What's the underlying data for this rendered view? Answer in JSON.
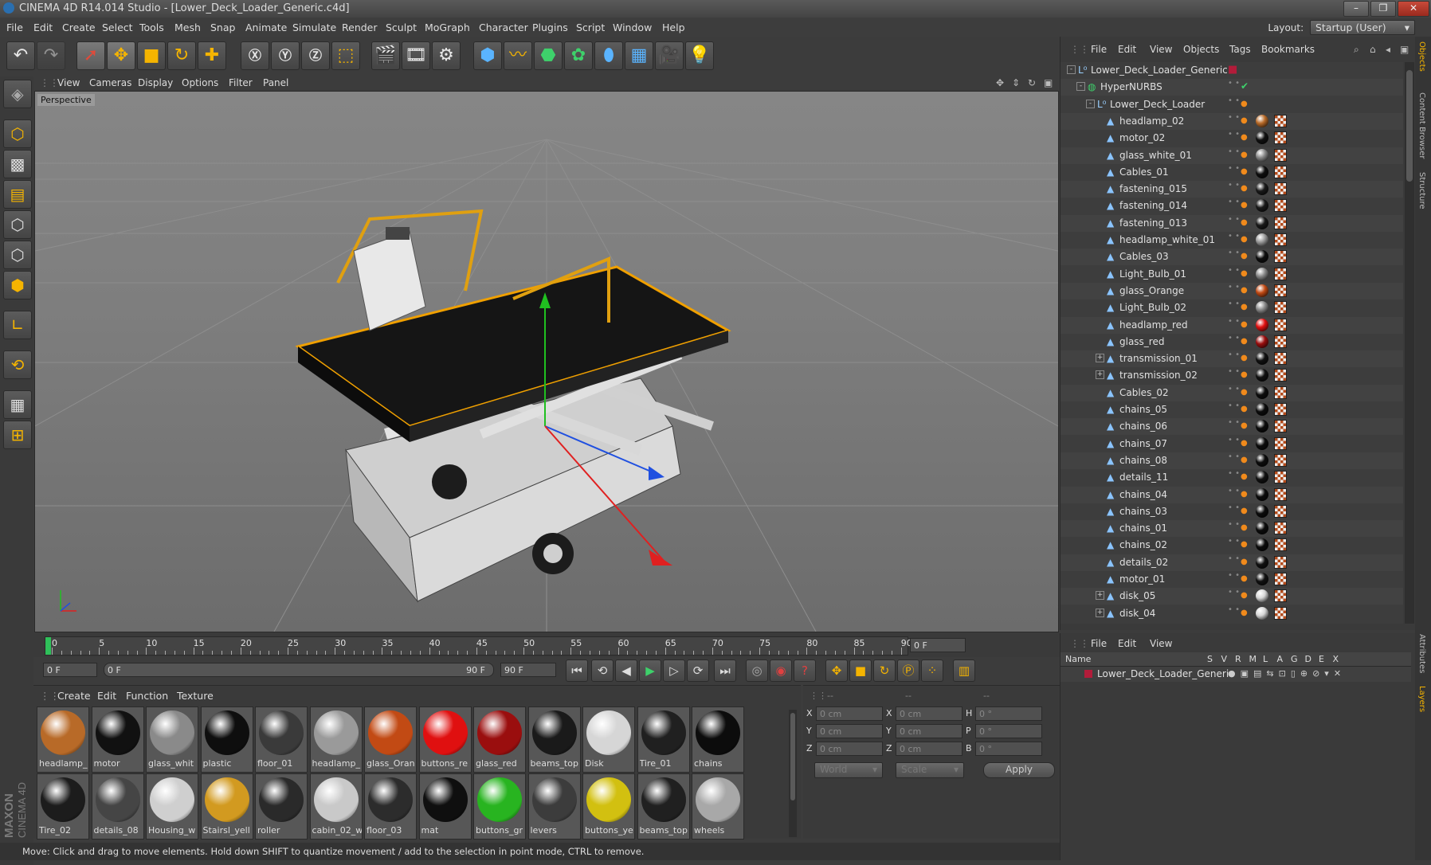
{
  "window": {
    "title": "CINEMA 4D R14.014 Studio - [Lower_Deck_Loader_Generic.c4d]"
  },
  "menu": [
    "File",
    "Edit",
    "Create",
    "Select",
    "Tools",
    "Mesh",
    "Snap",
    "Animate",
    "Simulate",
    "Render",
    "Sculpt",
    "MoGraph",
    "Character",
    "Plugins",
    "Script",
    "Window",
    "Help"
  ],
  "layout": {
    "label": "Layout:",
    "value": "Startup (User)"
  },
  "viewport": {
    "menu": [
      "View",
      "Cameras",
      "Display",
      "Options",
      "Filter",
      "Panel"
    ],
    "camera_label": "Perspective"
  },
  "timeline": {
    "ticks": [
      "0",
      "5",
      "10",
      "15",
      "20",
      "25",
      "30",
      "35",
      "40",
      "45",
      "50",
      "55",
      "60",
      "65",
      "70",
      "75",
      "80",
      "85",
      "90"
    ],
    "current_frame": "0 F",
    "start_field": "0 F",
    "range_start": "0 F",
    "range_end": "90 F",
    "end_field": "90 F"
  },
  "materials": {
    "menu": [
      "Create",
      "Edit",
      "Function",
      "Texture"
    ],
    "row1": [
      {
        "name": "headlamp_",
        "color": "#b86a28"
      },
      {
        "name": "motor",
        "color": "#111111"
      },
      {
        "name": "glass_whit",
        "color": "#8a8a8a"
      },
      {
        "name": "plastic",
        "color": "#0e0e0e"
      },
      {
        "name": "floor_01",
        "color": "#3a3a3a"
      },
      {
        "name": "headlamp_",
        "color": "#9a9a9a"
      },
      {
        "name": "glass_Oran",
        "color": "#c24a14"
      },
      {
        "name": "buttons_re",
        "color": "#e01010"
      },
      {
        "name": "glass_red",
        "color": "#9a0e0e"
      },
      {
        "name": "beams_top",
        "color": "#1a1a1a"
      },
      {
        "name": "Disk",
        "color": "#d6d6d6"
      },
      {
        "name": "Tire_01",
        "color": "#202020"
      },
      {
        "name": "chains",
        "color": "#0c0c0c"
      }
    ],
    "row2": [
      {
        "name": "Tire_02",
        "color": "#1c1c1c"
      },
      {
        "name": "details_08",
        "color": "#454545"
      },
      {
        "name": "Housing_w",
        "color": "#cfcfcf"
      },
      {
        "name": "Stairsl_yell",
        "color": "#d29a20"
      },
      {
        "name": "roller",
        "color": "#2a2a2a"
      },
      {
        "name": "cabin_02_w",
        "color": "#c9c9c9"
      },
      {
        "name": "floor_03",
        "color": "#2c2c2c"
      },
      {
        "name": "mat",
        "color": "#0f0f0f"
      },
      {
        "name": "buttons_gr",
        "color": "#28b420"
      },
      {
        "name": "levers",
        "color": "#3c3c3c"
      },
      {
        "name": "buttons_ye",
        "color": "#d2c010"
      },
      {
        "name": "beams_top",
        "color": "#202020"
      },
      {
        "name": "wheels",
        "color": "#a8a8a8"
      }
    ]
  },
  "coords": {
    "header": [
      "--",
      "--",
      "--"
    ],
    "rows": [
      {
        "a": "X",
        "av": "0 cm",
        "b": "X",
        "bv": "0 cm",
        "c": "H",
        "cv": "0 °"
      },
      {
        "a": "Y",
        "av": "0 cm",
        "b": "Y",
        "bv": "0 cm",
        "c": "P",
        "cv": "0 °"
      },
      {
        "a": "Z",
        "av": "0 cm",
        "b": "Z",
        "bv": "0 cm",
        "c": "B",
        "cv": "0 °"
      }
    ],
    "mode": "World",
    "scale": "Scale",
    "apply": "Apply"
  },
  "status": "Move: Click and drag to move elements. Hold down SHIFT to quantize movement / add to the selection in point mode, CTRL to remove.",
  "objects": {
    "menu": [
      "File",
      "Edit",
      "View",
      "Objects",
      "Tags",
      "Bookmarks"
    ],
    "items": [
      {
        "name": "Lower_Deck_Loader_Generic",
        "indent": 0,
        "type": "null",
        "mat": "",
        "expand": "-"
      },
      {
        "name": "HyperNURBS",
        "indent": 1,
        "type": "nurbs",
        "mat": "",
        "expand": "-"
      },
      {
        "name": "Lower_Deck_Loader",
        "indent": 2,
        "type": "null",
        "mat": "",
        "expand": "-"
      },
      {
        "name": "headlamp_02",
        "indent": 3,
        "type": "poly",
        "mat": "#b86a28",
        "expand": ""
      },
      {
        "name": "motor_02",
        "indent": 3,
        "type": "poly",
        "mat": "#111111",
        "expand": ""
      },
      {
        "name": "glass_white_01",
        "indent": 3,
        "type": "poly",
        "mat": "#8a8a8a",
        "expand": ""
      },
      {
        "name": "Cables_01",
        "indent": 3,
        "type": "poly",
        "mat": "#0e0e0e",
        "expand": ""
      },
      {
        "name": "fastening_015",
        "indent": 3,
        "type": "poly",
        "mat": "#1a1a1a",
        "expand": ""
      },
      {
        "name": "fastening_014",
        "indent": 3,
        "type": "poly",
        "mat": "#1a1a1a",
        "expand": ""
      },
      {
        "name": "fastening_013",
        "indent": 3,
        "type": "poly",
        "mat": "#1a1a1a",
        "expand": ""
      },
      {
        "name": "headlamp_white_01",
        "indent": 3,
        "type": "poly",
        "mat": "#9a9a9a",
        "expand": ""
      },
      {
        "name": "Cables_03",
        "indent": 3,
        "type": "poly",
        "mat": "#0e0e0e",
        "expand": ""
      },
      {
        "name": "Light_Bulb_01",
        "indent": 3,
        "type": "poly",
        "mat": "#8a8a8a",
        "expand": ""
      },
      {
        "name": "glass_Orange",
        "indent": 3,
        "type": "poly",
        "mat": "#c24a14",
        "expand": ""
      },
      {
        "name": "Light_Bulb_02",
        "indent": 3,
        "type": "poly",
        "mat": "#8a8a8a",
        "expand": ""
      },
      {
        "name": "headlamp_red",
        "indent": 3,
        "type": "poly",
        "mat": "#e01010",
        "expand": ""
      },
      {
        "name": "glass_red",
        "indent": 3,
        "type": "poly",
        "mat": "#9a0e0e",
        "expand": ""
      },
      {
        "name": "transmission_01",
        "indent": 3,
        "type": "poly",
        "mat": "#111111",
        "expand": "+"
      },
      {
        "name": "transmission_02",
        "indent": 3,
        "type": "poly",
        "mat": "#111111",
        "expand": "+"
      },
      {
        "name": "Cables_02",
        "indent": 3,
        "type": "poly",
        "mat": "#0e0e0e",
        "expand": ""
      },
      {
        "name": "chains_05",
        "indent": 3,
        "type": "poly",
        "mat": "#0c0c0c",
        "expand": ""
      },
      {
        "name": "chains_06",
        "indent": 3,
        "type": "poly",
        "mat": "#0c0c0c",
        "expand": ""
      },
      {
        "name": "chains_07",
        "indent": 3,
        "type": "poly",
        "mat": "#0c0c0c",
        "expand": ""
      },
      {
        "name": "chains_08",
        "indent": 3,
        "type": "poly",
        "mat": "#0c0c0c",
        "expand": ""
      },
      {
        "name": "details_11",
        "indent": 3,
        "type": "poly",
        "mat": "#111111",
        "expand": ""
      },
      {
        "name": "chains_04",
        "indent": 3,
        "type": "poly",
        "mat": "#0c0c0c",
        "expand": ""
      },
      {
        "name": "chains_03",
        "indent": 3,
        "type": "poly",
        "mat": "#0c0c0c",
        "expand": ""
      },
      {
        "name": "chains_01",
        "indent": 3,
        "type": "poly",
        "mat": "#0c0c0c",
        "expand": ""
      },
      {
        "name": "chains_02",
        "indent": 3,
        "type": "poly",
        "mat": "#0c0c0c",
        "expand": ""
      },
      {
        "name": "details_02",
        "indent": 3,
        "type": "poly",
        "mat": "#111111",
        "expand": ""
      },
      {
        "name": "motor_01",
        "indent": 3,
        "type": "poly",
        "mat": "#111111",
        "expand": ""
      },
      {
        "name": "disk_05",
        "indent": 3,
        "type": "poly",
        "mat": "#d6d6d6",
        "expand": "+"
      },
      {
        "name": "disk_04",
        "indent": 3,
        "type": "poly",
        "mat": "#d6d6d6",
        "expand": "+"
      }
    ]
  },
  "layers": {
    "menu": [
      "File",
      "Edit",
      "View"
    ],
    "columns": [
      "Name",
      "S",
      "V",
      "R",
      "M",
      "L",
      "A",
      "G",
      "D",
      "E",
      "X"
    ],
    "items": [
      "Lower_Deck_Loader_Generic"
    ]
  },
  "side_tabs": [
    "Objects",
    "Content Browser",
    "Structure",
    "Attributes",
    "Layers"
  ],
  "logo": {
    "brand": "MAXON",
    "product": "CINEMA 4D"
  },
  "colors": {
    "accent": "#f5b400",
    "axis_x": "#e02020",
    "axis_y": "#20c020",
    "axis_z": "#2050e0"
  }
}
